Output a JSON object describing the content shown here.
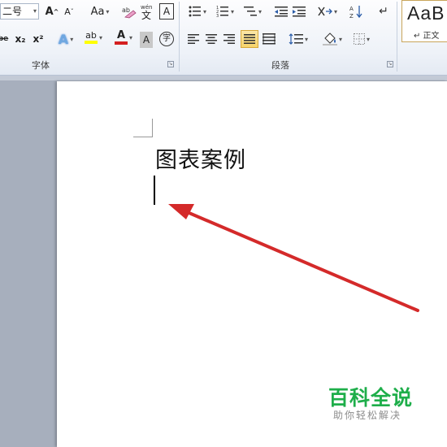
{
  "ribbon": {
    "font_group": {
      "label": "字体",
      "font_size": "二号",
      "grow_label": "A",
      "shrink_label": "A",
      "change_case_label": "Aa",
      "clear_format_label": "Aa",
      "phonetic_label": "wén",
      "border_char_label": "A",
      "strike_label": "abc",
      "subscript_label": "x₂",
      "superscript_label": "x²",
      "text_effect_label": "A",
      "highlight_label": "ab",
      "font_color_label": "A",
      "shading_label": "A",
      "enclose_label": "字"
    },
    "paragraph_group": {
      "label": "段落"
    },
    "styles": {
      "preview": "AaB",
      "name": "↵ 正文"
    }
  },
  "document": {
    "text": "图表案例"
  },
  "watermark": {
    "title": "百科全说",
    "subtitle": "助你轻松解决"
  },
  "colors": {
    "arrow": "#d42a2a",
    "watermark": "#1eae4a",
    "highlight_bar": "#ffff00",
    "font_color_bar": "#d42020"
  }
}
